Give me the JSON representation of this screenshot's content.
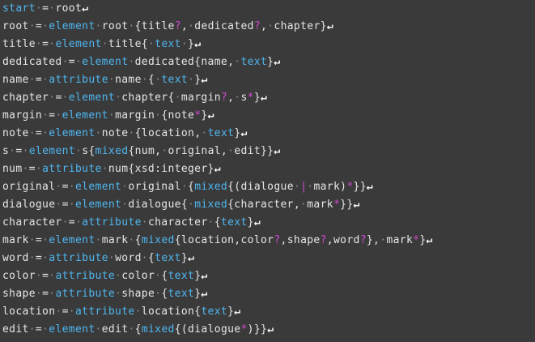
{
  "editor": {
    "lines": [
      [
        [
          "kw",
          "start"
        ],
        [
          "ws",
          "·"
        ],
        [
          "op",
          "="
        ],
        [
          "ws",
          "·"
        ],
        [
          "id",
          "root"
        ],
        [
          "nl",
          "↵"
        ]
      ],
      [
        [
          "id",
          "root"
        ],
        [
          "ws",
          "·"
        ],
        [
          "op",
          "="
        ],
        [
          "ws",
          "·"
        ],
        [
          "kw",
          "element"
        ],
        [
          "ws",
          "·"
        ],
        [
          "id",
          "root"
        ],
        [
          "ws",
          "·"
        ],
        [
          "op",
          "{title"
        ],
        [
          "mod",
          "?"
        ],
        [
          "op",
          ","
        ],
        [
          "ws",
          "·"
        ],
        [
          "id",
          "dedicated"
        ],
        [
          "mod",
          "?"
        ],
        [
          "op",
          ","
        ],
        [
          "ws",
          "·"
        ],
        [
          "id",
          "chapter}"
        ],
        [
          "nl",
          "↵"
        ]
      ],
      [
        [
          "id",
          "title"
        ],
        [
          "ws",
          "·"
        ],
        [
          "op",
          "="
        ],
        [
          "ws",
          "·"
        ],
        [
          "kw",
          "element"
        ],
        [
          "ws",
          "·"
        ],
        [
          "id",
          "title{"
        ],
        [
          "ws",
          "·"
        ],
        [
          "kw",
          "text"
        ],
        [
          "ws",
          "·"
        ],
        [
          "op",
          "}"
        ],
        [
          "nl",
          "↵"
        ]
      ],
      [
        [
          "id",
          "dedicated"
        ],
        [
          "ws",
          "·"
        ],
        [
          "op",
          "="
        ],
        [
          "ws",
          "·"
        ],
        [
          "kw",
          "element"
        ],
        [
          "ws",
          "·"
        ],
        [
          "id",
          "dedicated{name,"
        ],
        [
          "ws",
          "·"
        ],
        [
          "kw",
          "text"
        ],
        [
          "op",
          "}"
        ],
        [
          "nl",
          "↵"
        ]
      ],
      [
        [
          "id",
          "name"
        ],
        [
          "ws",
          "·"
        ],
        [
          "op",
          "="
        ],
        [
          "ws",
          "·"
        ],
        [
          "kw",
          "attribute"
        ],
        [
          "ws",
          "·"
        ],
        [
          "id",
          "name"
        ],
        [
          "ws",
          "·"
        ],
        [
          "op",
          "{"
        ],
        [
          "ws",
          "·"
        ],
        [
          "kw",
          "text"
        ],
        [
          "ws",
          "·"
        ],
        [
          "op",
          "}"
        ],
        [
          "nl",
          "↵"
        ]
      ],
      [
        [
          "id",
          "chapter"
        ],
        [
          "ws",
          "·"
        ],
        [
          "op",
          "="
        ],
        [
          "ws",
          "·"
        ],
        [
          "kw",
          "element"
        ],
        [
          "ws",
          "·"
        ],
        [
          "id",
          "chapter{"
        ],
        [
          "ws",
          "·"
        ],
        [
          "id",
          "margin"
        ],
        [
          "mod",
          "?"
        ],
        [
          "op",
          ","
        ],
        [
          "ws",
          "·"
        ],
        [
          "id",
          "s"
        ],
        [
          "mod",
          "*"
        ],
        [
          "op",
          "}"
        ],
        [
          "nl",
          "↵"
        ]
      ],
      [
        [
          "id",
          "margin"
        ],
        [
          "ws",
          "·"
        ],
        [
          "op",
          "="
        ],
        [
          "ws",
          "·"
        ],
        [
          "kw",
          "element"
        ],
        [
          "ws",
          "·"
        ],
        [
          "id",
          "margin"
        ],
        [
          "ws",
          "·"
        ],
        [
          "op",
          "{note"
        ],
        [
          "mod",
          "*"
        ],
        [
          "op",
          "}"
        ],
        [
          "nl",
          "↵"
        ]
      ],
      [
        [
          "id",
          "note"
        ],
        [
          "ws",
          "·"
        ],
        [
          "op",
          "="
        ],
        [
          "ws",
          "·"
        ],
        [
          "kw",
          "element"
        ],
        [
          "ws",
          "·"
        ],
        [
          "id",
          "note"
        ],
        [
          "ws",
          "·"
        ],
        [
          "op",
          "{location,"
        ],
        [
          "ws",
          "·"
        ],
        [
          "kw",
          "text"
        ],
        [
          "op",
          "}"
        ],
        [
          "nl",
          "↵"
        ]
      ],
      [
        [
          "id",
          "s"
        ],
        [
          "ws",
          "·"
        ],
        [
          "op",
          "="
        ],
        [
          "ws",
          "·"
        ],
        [
          "kw",
          "element"
        ],
        [
          "ws",
          "·"
        ],
        [
          "id",
          "s{"
        ],
        [
          "kw",
          "mixed"
        ],
        [
          "op",
          "{num,"
        ],
        [
          "ws",
          "·"
        ],
        [
          "id",
          "original,"
        ],
        [
          "ws",
          "·"
        ],
        [
          "id",
          "edit}}"
        ],
        [
          "nl",
          "↵"
        ]
      ],
      [
        [
          "id",
          "num"
        ],
        [
          "ws",
          "·"
        ],
        [
          "op",
          "="
        ],
        [
          "ws",
          "·"
        ],
        [
          "kw",
          "attribute"
        ],
        [
          "ws",
          "·"
        ],
        [
          "id",
          "num{xsd:integer}"
        ],
        [
          "nl",
          "↵"
        ]
      ],
      [
        [
          "id",
          "original"
        ],
        [
          "ws",
          "·"
        ],
        [
          "op",
          "="
        ],
        [
          "ws",
          "·"
        ],
        [
          "kw",
          "element"
        ],
        [
          "ws",
          "·"
        ],
        [
          "id",
          "original"
        ],
        [
          "ws",
          "·"
        ],
        [
          "op",
          "{"
        ],
        [
          "kw",
          "mixed"
        ],
        [
          "op",
          "{(dialogue"
        ],
        [
          "ws",
          "·"
        ],
        [
          "mod",
          "|"
        ],
        [
          "ws",
          "·"
        ],
        [
          "id",
          "mark)"
        ],
        [
          "mod",
          "*"
        ],
        [
          "op",
          "}}"
        ],
        [
          "nl",
          "↵"
        ]
      ],
      [
        [
          "id",
          "dialogue"
        ],
        [
          "ws",
          "·"
        ],
        [
          "op",
          "="
        ],
        [
          "ws",
          "·"
        ],
        [
          "kw",
          "element"
        ],
        [
          "ws",
          "·"
        ],
        [
          "id",
          "dialogue{"
        ],
        [
          "ws",
          "·"
        ],
        [
          "kw",
          "mixed"
        ],
        [
          "op",
          "{character,"
        ],
        [
          "ws",
          "·"
        ],
        [
          "id",
          "mark"
        ],
        [
          "mod",
          "*"
        ],
        [
          "op",
          "}}"
        ],
        [
          "nl",
          "↵"
        ]
      ],
      [
        [
          "id",
          "character"
        ],
        [
          "ws",
          "·"
        ],
        [
          "op",
          "="
        ],
        [
          "ws",
          "·"
        ],
        [
          "kw",
          "attribute"
        ],
        [
          "ws",
          "·"
        ],
        [
          "id",
          "character"
        ],
        [
          "ws",
          "·"
        ],
        [
          "op",
          "{"
        ],
        [
          "kw",
          "text"
        ],
        [
          "op",
          "}"
        ],
        [
          "nl",
          "↵"
        ]
      ],
      [
        [
          "id",
          "mark"
        ],
        [
          "ws",
          "·"
        ],
        [
          "op",
          "="
        ],
        [
          "ws",
          "·"
        ],
        [
          "kw",
          "element"
        ],
        [
          "ws",
          "·"
        ],
        [
          "id",
          "mark"
        ],
        [
          "ws",
          "·"
        ],
        [
          "op",
          "{"
        ],
        [
          "kw",
          "mixed"
        ],
        [
          "op",
          "{location,color"
        ],
        [
          "mod",
          "?"
        ],
        [
          "op",
          ",shape"
        ],
        [
          "mod",
          "?"
        ],
        [
          "op",
          ",word"
        ],
        [
          "mod",
          "?"
        ],
        [
          "op",
          "},"
        ],
        [
          "ws",
          "·"
        ],
        [
          "id",
          "mark"
        ],
        [
          "mod",
          "*"
        ],
        [
          "op",
          "}"
        ],
        [
          "nl",
          "↵"
        ]
      ],
      [
        [
          "id",
          "word"
        ],
        [
          "ws",
          "·"
        ],
        [
          "op",
          "="
        ],
        [
          "ws",
          "·"
        ],
        [
          "kw",
          "attribute"
        ],
        [
          "ws",
          "·"
        ],
        [
          "id",
          "word"
        ],
        [
          "ws",
          "·"
        ],
        [
          "op",
          "{"
        ],
        [
          "kw",
          "text"
        ],
        [
          "op",
          "}"
        ],
        [
          "nl",
          "↵"
        ]
      ],
      [
        [
          "id",
          "color"
        ],
        [
          "ws",
          "·"
        ],
        [
          "op",
          "="
        ],
        [
          "ws",
          "·"
        ],
        [
          "kw",
          "attribute"
        ],
        [
          "ws",
          "·"
        ],
        [
          "id",
          "color"
        ],
        [
          "ws",
          "·"
        ],
        [
          "op",
          "{"
        ],
        [
          "kw",
          "text"
        ],
        [
          "op",
          "}"
        ],
        [
          "nl",
          "↵"
        ]
      ],
      [
        [
          "id",
          "shape"
        ],
        [
          "ws",
          "·"
        ],
        [
          "op",
          "="
        ],
        [
          "ws",
          "·"
        ],
        [
          "kw",
          "attribute"
        ],
        [
          "ws",
          "·"
        ],
        [
          "id",
          "shape"
        ],
        [
          "ws",
          "·"
        ],
        [
          "op",
          "{"
        ],
        [
          "kw",
          "text"
        ],
        [
          "op",
          "}"
        ],
        [
          "nl",
          "↵"
        ]
      ],
      [
        [
          "id",
          "location"
        ],
        [
          "ws",
          "·"
        ],
        [
          "op",
          "="
        ],
        [
          "ws",
          "·"
        ],
        [
          "kw",
          "attribute"
        ],
        [
          "ws",
          "·"
        ],
        [
          "id",
          "location{"
        ],
        [
          "kw",
          "text"
        ],
        [
          "op",
          "}"
        ],
        [
          "nl",
          "↵"
        ]
      ],
      [
        [
          "id",
          "edit"
        ],
        [
          "ws",
          "·"
        ],
        [
          "op",
          "="
        ],
        [
          "ws",
          "·"
        ],
        [
          "kw",
          "element"
        ],
        [
          "ws",
          "·"
        ],
        [
          "id",
          "edit"
        ],
        [
          "ws",
          "·"
        ],
        [
          "op",
          "{"
        ],
        [
          "kw",
          "mixed"
        ],
        [
          "op",
          "{(dialogue"
        ],
        [
          "mod",
          "*"
        ],
        [
          "op",
          ")}}"
        ],
        [
          "nl",
          "↵"
        ]
      ]
    ]
  },
  "colors": {
    "background": "#3a3a3a",
    "keyword": "#4fb6f0",
    "identifier": "#e6e6e6",
    "modifier": "#d04ad0",
    "whitespace_marker": "#8a8a8a",
    "newline_marker": "#ffffff"
  }
}
